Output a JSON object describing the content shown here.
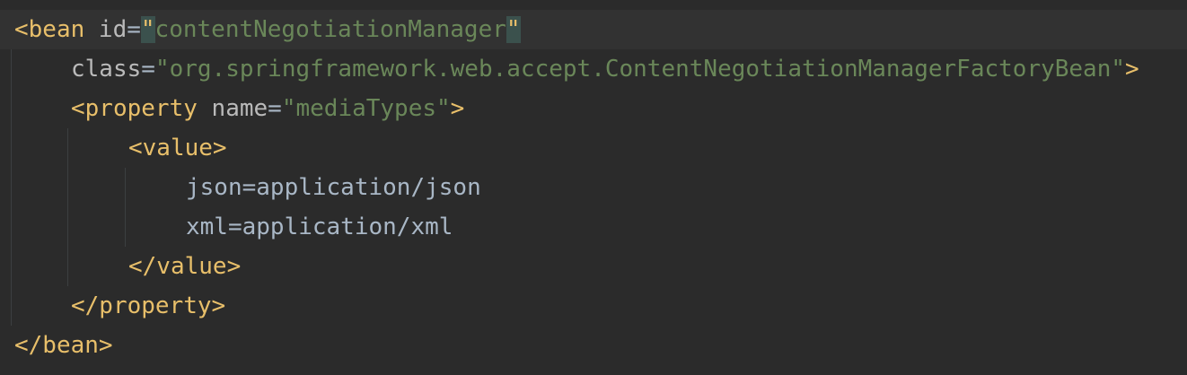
{
  "editor": {
    "lines": [
      {
        "parts": [
          {
            "t": "tag",
            "v": "<bean "
          },
          {
            "t": "attr",
            "v": "id"
          },
          {
            "t": "eq",
            "v": "="
          },
          {
            "t": "quote",
            "v": "\""
          },
          {
            "t": "str",
            "v": "contentNegotiationManager"
          },
          {
            "t": "quote",
            "v": "\""
          }
        ]
      },
      {
        "parts": [
          {
            "t": "attr",
            "v": "class"
          },
          {
            "t": "eq",
            "v": "="
          },
          {
            "t": "str",
            "v": "\"org.springframework.web.accept.ContentNegotiationManagerFactoryBean\""
          },
          {
            "t": "tag",
            "v": ">"
          }
        ]
      },
      {
        "parts": [
          {
            "t": "tag",
            "v": "<property "
          },
          {
            "t": "attr",
            "v": "name"
          },
          {
            "t": "eq",
            "v": "="
          },
          {
            "t": "str",
            "v": "\"mediaTypes\""
          },
          {
            "t": "tag",
            "v": ">"
          }
        ]
      },
      {
        "parts": [
          {
            "t": "tag",
            "v": "<value>"
          }
        ]
      },
      {
        "parts": [
          {
            "t": "text",
            "v": "json=application/json"
          }
        ]
      },
      {
        "parts": [
          {
            "t": "text",
            "v": "xml=application/xml"
          }
        ]
      },
      {
        "parts": [
          {
            "t": "tag",
            "v": "</value>"
          }
        ]
      },
      {
        "parts": [
          {
            "t": "tag",
            "v": "</property>"
          }
        ]
      },
      {
        "parts": [
          {
            "t": "tag",
            "v": "</bean>"
          }
        ]
      }
    ]
  },
  "colors": {
    "background": "#2b2b2b",
    "current_line": "#323232",
    "tag": "#e8bf6a",
    "attribute": "#bababa",
    "string": "#6a8759",
    "text": "#a9b7c6",
    "bracket_match": "#3b514d"
  }
}
